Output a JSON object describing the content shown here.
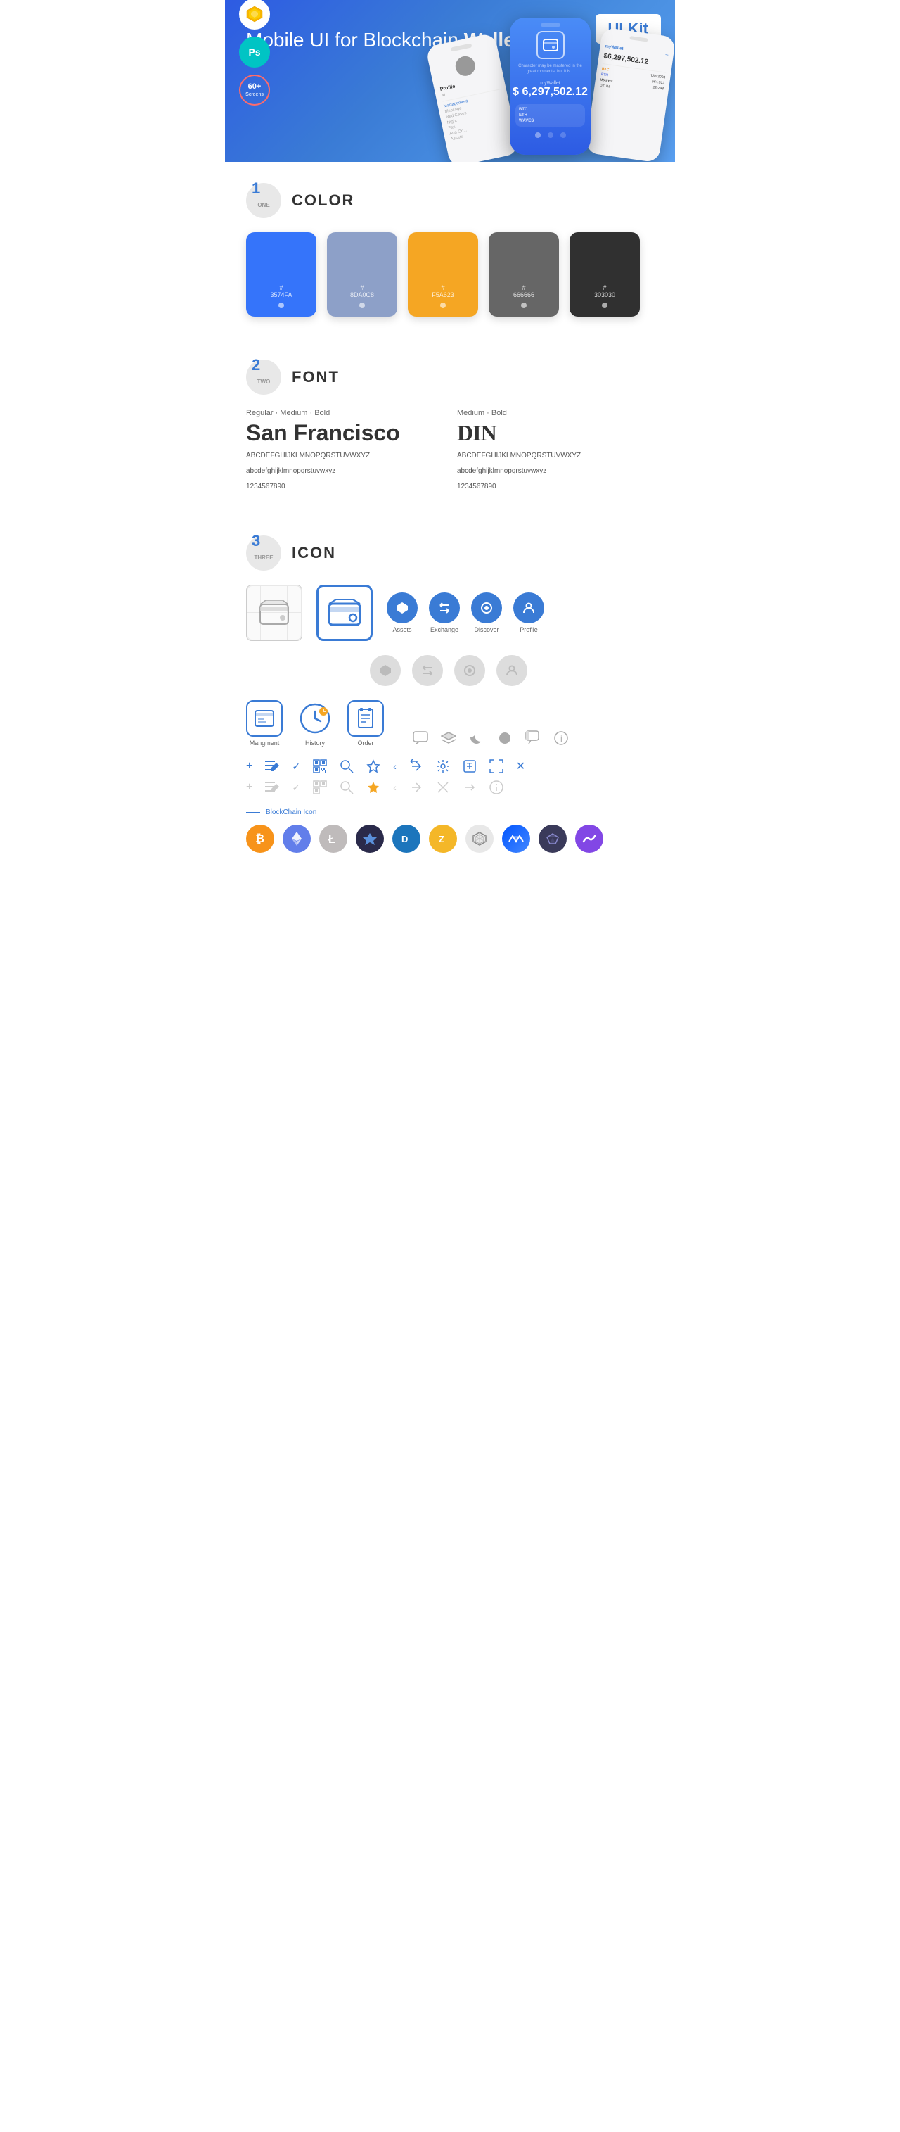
{
  "hero": {
    "title_normal": "Mobile UI for Blockchain ",
    "title_bold": "Wallet",
    "badge": "UI Kit",
    "badges": [
      {
        "id": "sketch",
        "label": "Sketch"
      },
      {
        "id": "ps",
        "label": "Ps"
      },
      {
        "id": "screens",
        "line1": "60+",
        "line2": "Screens"
      }
    ]
  },
  "sections": {
    "color": {
      "number": "1",
      "number_word": "ONE",
      "title": "COLOR",
      "swatches": [
        {
          "id": "blue",
          "hex": "#3574FA",
          "label": "#\n3574FA",
          "bg": "#3574FA"
        },
        {
          "id": "slate",
          "hex": "#8DA0C8",
          "label": "#\n8DA0C8",
          "bg": "#8DA0C8"
        },
        {
          "id": "orange",
          "hex": "#F5A623",
          "label": "#\nF5A623",
          "bg": "#F5A623"
        },
        {
          "id": "gray",
          "hex": "#666666",
          "label": "#\n666666",
          "bg": "#666666"
        },
        {
          "id": "dark",
          "hex": "#303030",
          "label": "#\n303030",
          "bg": "#303030"
        }
      ]
    },
    "font": {
      "number": "2",
      "number_word": "TWO",
      "title": "FONT",
      "fonts": [
        {
          "id": "san-francisco",
          "style_label": "Regular · Medium · Bold",
          "name": "San Francisco",
          "uppercase": "ABCDEFGHIJKLMNOPQRSTUVWXYZ",
          "lowercase": "abcdefghijklmnopqrstuvwxyz",
          "numbers": "1234567890"
        },
        {
          "id": "din",
          "style_label": "Medium · Bold",
          "name": "DIN",
          "uppercase": "ABCDEFGHIJKLMNOPQRSTUVWXYZ",
          "lowercase": "abcdefghijklmnopqrstuvwxyz",
          "numbers": "1234567890"
        }
      ]
    },
    "icon": {
      "number": "3",
      "number_word": "THREE",
      "title": "ICON",
      "named_icons": [
        {
          "id": "assets",
          "label": "Assets"
        },
        {
          "id": "exchange",
          "label": "Exchange"
        },
        {
          "id": "discover",
          "label": "Discover"
        },
        {
          "id": "profile",
          "label": "Profile"
        }
      ],
      "app_icons": [
        {
          "id": "management",
          "label": "Mangment"
        },
        {
          "id": "history",
          "label": "History"
        },
        {
          "id": "order",
          "label": "Order"
        }
      ],
      "blockchain_label": "BlockChain Icon",
      "crypto_coins": [
        {
          "id": "bitcoin",
          "symbol": "₿",
          "color": "#F7931A",
          "bg": "#F7931A"
        },
        {
          "id": "ethereum",
          "symbol": "⬡",
          "color": "#627EEA",
          "bg": "#627EEA"
        },
        {
          "id": "litecoin",
          "symbol": "Ł",
          "color": "#BFBBBB",
          "bg": "#BFBBBB"
        },
        {
          "id": "token4",
          "symbol": "◈",
          "color": "#1a1a2e",
          "bg": "#1a1a2e"
        },
        {
          "id": "dash",
          "symbol": "D",
          "color": "#1C75BC",
          "bg": "#1C75BC"
        },
        {
          "id": "zcash",
          "symbol": "Z",
          "color": "#F4B728",
          "bg": "#F4B728"
        },
        {
          "id": "token7",
          "symbol": "✦",
          "color": "#aaa",
          "bg": "#e8e8e8"
        },
        {
          "id": "waves",
          "symbol": "W",
          "color": "#0155FF",
          "bg": "#0155FF"
        },
        {
          "id": "token9",
          "symbol": "◆",
          "color": "#4a4a6a",
          "bg": "#4a4a6a"
        },
        {
          "id": "token10",
          "symbol": "~",
          "color": "#e44",
          "bg": "#e44"
        }
      ]
    }
  }
}
